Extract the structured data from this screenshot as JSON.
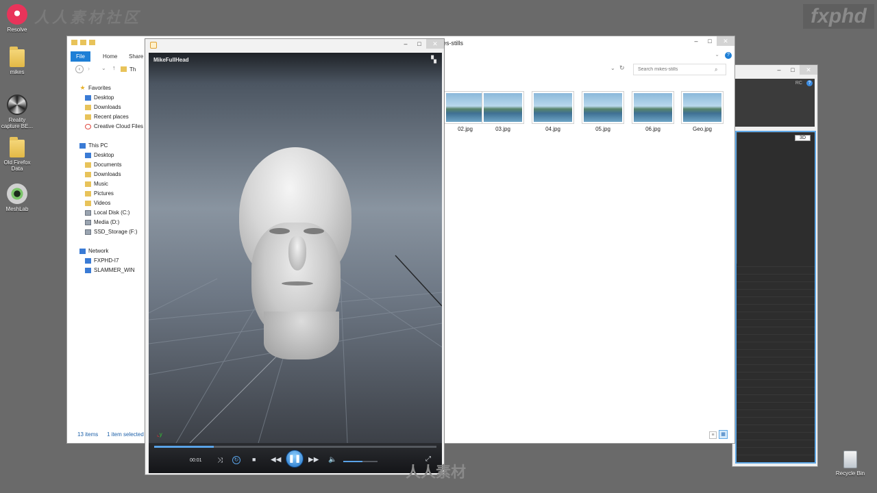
{
  "desktop": {
    "icons": [
      {
        "label": "Resolve"
      },
      {
        "label": "mikes"
      },
      {
        "label": "Reality capture BE..."
      },
      {
        "label": "Old Firefox Data"
      },
      {
        "label": "MeshLab"
      }
    ],
    "recycle_bin": "Recycle Bin",
    "brand_right": "fxphd",
    "brand_left": "人人素材社区",
    "watermark_bottom": "人人素材"
  },
  "rc_window": {
    "label_rc": "RC",
    "badge_3d": "3D"
  },
  "explorer": {
    "title_fragment": "es-stills",
    "tabs": [
      "File",
      "Home",
      "Share"
    ],
    "address_fragment": "Th",
    "search_placeholder": "Search mikes-stills",
    "nav": {
      "favorites": "Favorites",
      "fav_items": [
        "Desktop",
        "Downloads",
        "Recent places",
        "Creative Cloud Files"
      ],
      "thispc": "This PC",
      "pc_items": [
        "Desktop",
        "Documents",
        "Downloads",
        "Music",
        "Pictures",
        "Videos",
        "Local Disk (C:)",
        "Media (D:)",
        "SSD_Storage (F:)"
      ],
      "network": "Network",
      "net_items": [
        "FXPHD-I7",
        "SLAMMER_WIN"
      ]
    },
    "files": [
      "02.jpg",
      "03.jpg",
      "04.jpg",
      "05.jpg",
      "06.jpg",
      "Geo.jpg"
    ],
    "status_items": "13 items",
    "status_selected": "1 item selected"
  },
  "player": {
    "title": "MikeFullHead",
    "time": "00:01",
    "progress": 0.21,
    "volume": 0.55
  },
  "colors": {
    "accent": "#1e7fd6",
    "desktop": "#6a6a6a"
  }
}
